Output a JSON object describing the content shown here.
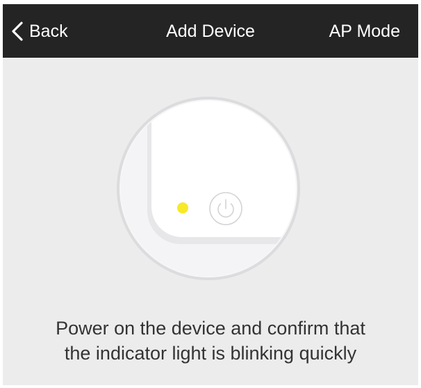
{
  "nav": {
    "back_label": "Back",
    "title": "Add Device",
    "mode_label": "AP Mode"
  },
  "illustration": {
    "indicator_color": "#f7e92a",
    "icons": [
      "indicator-light-icon",
      "power-icon"
    ]
  },
  "instruction": {
    "line1": "Power on the device and confirm that",
    "line2": "the indicator light is blinking quickly"
  },
  "colors": {
    "nav_background": "#242424",
    "page_background": "#ececed",
    "text": "#333333"
  }
}
